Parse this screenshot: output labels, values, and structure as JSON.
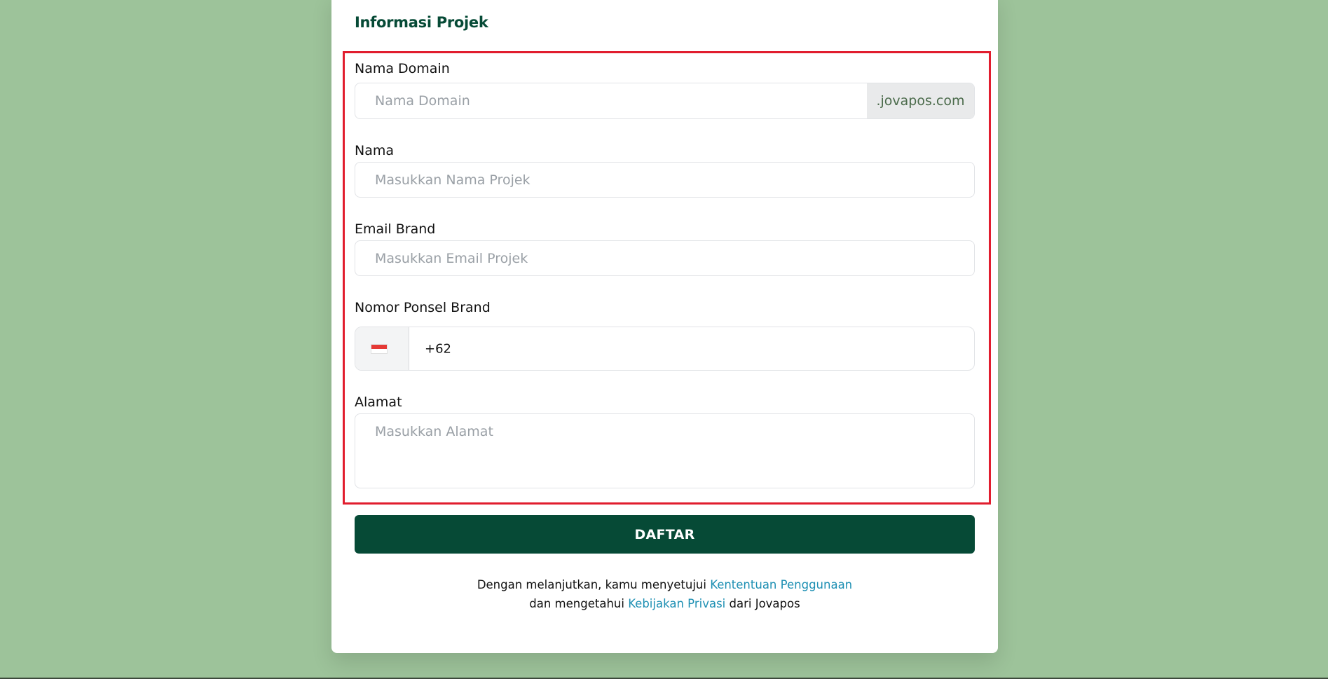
{
  "section": {
    "title": "Informasi Projek"
  },
  "form": {
    "domain": {
      "label": "Nama Domain",
      "placeholder": "Nama Domain",
      "suffix": ".jovapos.com"
    },
    "name": {
      "label": "Nama",
      "placeholder": "Masukkan Nama Projek"
    },
    "email": {
      "label": "Email Brand",
      "placeholder": "Masukkan Email Projek"
    },
    "phone": {
      "label": "Nomor Ponsel Brand",
      "country_code": "+62",
      "flag_icon": "indonesia-flag-icon"
    },
    "address": {
      "label": "Alamat",
      "placeholder": "Masukkan Alamat"
    }
  },
  "actions": {
    "submit_label": "DAFTAR"
  },
  "terms": {
    "line1_prefix": "Dengan melanjutkan, kamu menyetujui ",
    "terms_link": "Kententuan Penggunaan",
    "line2_prefix": "dan mengetahui ",
    "privacy_link": "Kebijakan Privasi",
    "line2_suffix": " dari Jovapos"
  },
  "colors": {
    "page_background": "#9dc39a",
    "primary": "#064a36",
    "highlight_border": "#e11d2e",
    "link": "#1d8fb3"
  }
}
